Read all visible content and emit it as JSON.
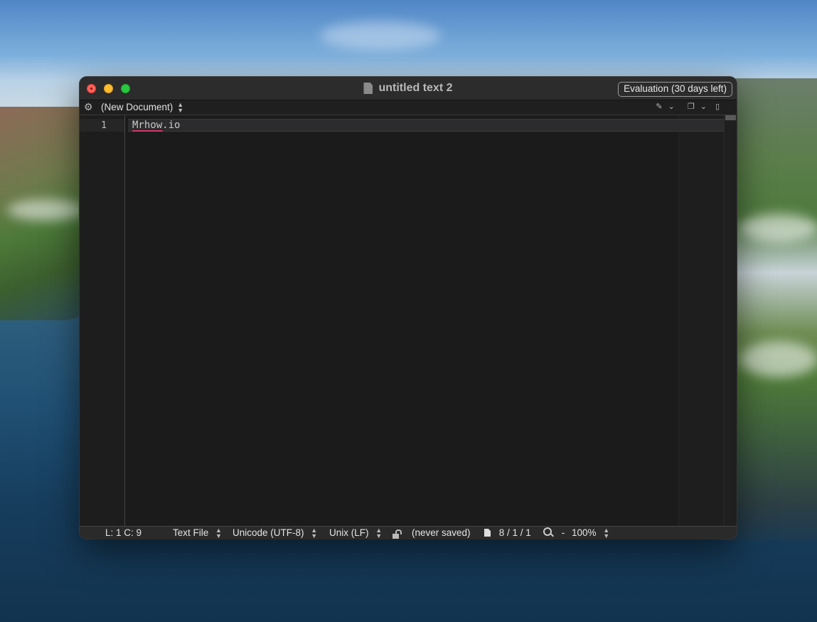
{
  "window": {
    "title": "untitled text 2",
    "evaluation_label": "Evaluation (30 days left)"
  },
  "navbar": {
    "document_selector": "(New Document)",
    "icons": [
      "gear-icon",
      "pencil-icon",
      "chevron-down-icon",
      "copy-icon",
      "chevron-down-icon",
      "document-icon"
    ]
  },
  "editor": {
    "line_numbers": [
      "1"
    ],
    "lines": [
      "Mrhow.io"
    ]
  },
  "statusbar": {
    "position": "L: 1 C: 9",
    "file_type": "Text File",
    "encoding": "Unicode (UTF-8)",
    "line_endings": "Unix (LF)",
    "save_state": "(never saved)",
    "counts": "8 / 1 / 1",
    "zoom_minus": "-",
    "zoom": "100%"
  },
  "colors": {
    "close": "#fe5f57",
    "minimize": "#febc2e",
    "maximize": "#28c840",
    "spellcheck_underline": "#d8336b"
  }
}
